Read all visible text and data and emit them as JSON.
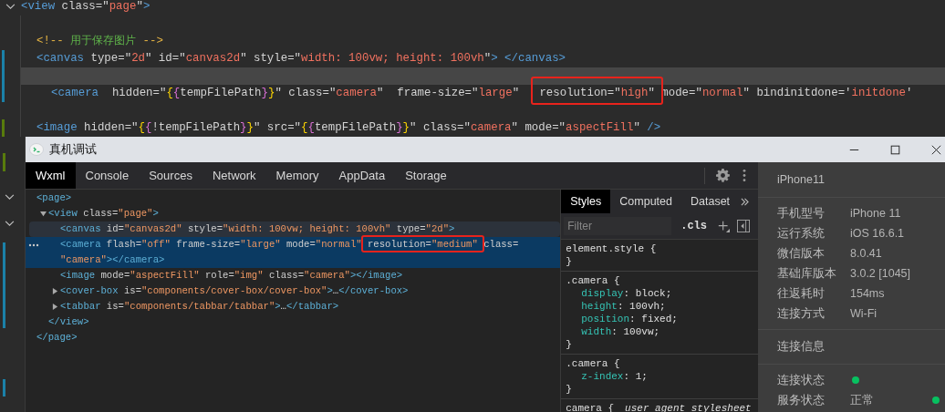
{
  "editor": {
    "lines": [
      {
        "expanded": true,
        "current": false,
        "tokens": [
          {
            "kind": "tag",
            "text": "<view"
          },
          {
            "kind": "attr",
            "text": " class=\""
          },
          {
            "kind": "str",
            "text": "page"
          },
          {
            "kind": "attr",
            "text": "\""
          },
          {
            "kind": "tag",
            "text": ">"
          }
        ],
        "children": [
          {
            "current": false
          },
          {
            "current": false,
            "tokens": [
              {
                "kind": "cmark",
                "text": "<!-- "
              },
              {
                "kind": "comment",
                "text": "用于保存图片"
              },
              {
                "kind": "cmark",
                "text": " -->"
              }
            ]
          },
          {
            "color": "#1b81a8",
            "current": false,
            "tokens": [
              {
                "kind": "tag",
                "text": "<canvas"
              },
              {
                "kind": "attr",
                "text": " type=\""
              },
              {
                "kind": "str",
                "text": "2d"
              },
              {
                "kind": "attr",
                "text": "\" id=\""
              },
              {
                "kind": "str",
                "text": "canvas2d"
              },
              {
                "kind": "attr",
                "text": "\" style=\""
              },
              {
                "kind": "str",
                "text": "width: 100vw; height: 100vh"
              },
              {
                "kind": "attr",
                "text": "\""
              },
              {
                "kind": "tag",
                "text": "> </canvas>"
              }
            ],
            "children": [
              {
                "color": "#1b81a8",
                "current": true
              },
              {
                "color": "#1b81a8",
                "current": false,
                "tokens": [
                  {
                    "kind": "tag",
                    "text": "<camera"
                  },
                  {
                    "kind": "attr",
                    "text": "  hidden=\""
                  },
                  {
                    "kind": "b1",
                    "text": "{"
                  },
                  {
                    "kind": "b2",
                    "text": "{"
                  },
                  {
                    "kind": "attr",
                    "text": "tempFilePath"
                  },
                  {
                    "kind": "b2",
                    "text": "}"
                  },
                  {
                    "kind": "b1",
                    "text": "}"
                  },
                  {
                    "kind": "attr",
                    "text": "\" class=\""
                  },
                  {
                    "kind": "str",
                    "text": "camera"
                  },
                  {
                    "kind": "attr",
                    "text": "\"  frame-size=\""
                  },
                  {
                    "kind": "str",
                    "text": "large"
                  },
                  {
                    "kind": "attr",
                    "text": "\"   "
                  },
                  {
                    "kind": "group",
                    "boxed": true,
                    "tokens": [
                      {
                        "kind": "attr",
                        "text": "resolution=\""
                      },
                      {
                        "kind": "str",
                        "text": "high"
                      },
                      {
                        "kind": "attr",
                        "text": "\""
                      }
                    ]
                  },
                  {
                    "kind": "attr",
                    "text": " mode=\""
                  },
                  {
                    "kind": "str",
                    "text": "normal"
                  },
                  {
                    "kind": "attr",
                    "text": "\" bindinitdone='"
                  },
                  {
                    "kind": "str",
                    "text": "initdone"
                  },
                  {
                    "kind": "attr",
                    "text": "'"
                  }
                ]
              },
              {
                "current": false
              }
            ]
          },
          {
            "color": "#587c0c",
            "current": false,
            "tokens": [
              {
                "kind": "tag",
                "text": "<image"
              },
              {
                "kind": "attr",
                "text": " hidden=\""
              },
              {
                "kind": "b1",
                "text": "{"
              },
              {
                "kind": "b2",
                "text": "{"
              },
              {
                "kind": "attr",
                "text": "!tempFilePath"
              },
              {
                "kind": "b2",
                "text": "}"
              },
              {
                "kind": "b1",
                "text": "}"
              },
              {
                "kind": "attr",
                "text": "\" src=\""
              },
              {
                "kind": "b1",
                "text": "{"
              },
              {
                "kind": "b2",
                "text": "{"
              },
              {
                "kind": "attr",
                "text": "tempFilePath"
              },
              {
                "kind": "b2",
                "text": "}"
              },
              {
                "kind": "b1",
                "text": "}"
              },
              {
                "kind": "attr",
                "text": "\" class=\""
              },
              {
                "kind": "str",
                "text": "camera"
              },
              {
                "kind": "attr",
                "text": "\" mode=\""
              },
              {
                "kind": "str",
                "text": "aspectFill"
              },
              {
                "kind": "attr",
                "text": "\" "
              },
              {
                "kind": "tag",
                "text": "/>"
              }
            ]
          }
        ]
      }
    ]
  },
  "window": {
    "title": "真机调试"
  },
  "tabs": [
    {
      "label": "Wxml",
      "selected": true
    },
    {
      "label": "Console",
      "selected": false
    },
    {
      "label": "Sources",
      "selected": false
    },
    {
      "label": "Network",
      "selected": false
    },
    {
      "label": "Memory",
      "selected": false
    },
    {
      "label": "AppData",
      "selected": false
    },
    {
      "label": "Storage",
      "selected": false
    }
  ],
  "tree": {
    "nodes": [
      {
        "selected": false,
        "hovered": false,
        "lines": [
          [
            {
              "kind": "tag",
              "text": "<page>"
            }
          ]
        ],
        "close": [
          {
            "kind": "tag",
            "text": "</page>"
          }
        ],
        "children": [
          {
            "selected": false,
            "hovered": false,
            "expanded": true,
            "lines": [
              [
                {
                  "kind": "tag",
                  "text": "<view"
                },
                {
                  "kind": "attr",
                  "text": " class="
                },
                {
                  "kind": "str",
                  "text": "\"page\""
                },
                {
                  "kind": "tag",
                  "text": ">"
                }
              ]
            ],
            "close": [
              {
                "kind": "tag",
                "text": "</view>"
              }
            ],
            "children": [
              {
                "selected": false,
                "hovered": true,
                "lines": [
                  [
                    {
                      "kind": "tag",
                      "text": "<canvas"
                    },
                    {
                      "kind": "attr",
                      "text": " id="
                    },
                    {
                      "kind": "str",
                      "text": "\"canvas2d\""
                    },
                    {
                      "kind": "attr",
                      "text": " style="
                    },
                    {
                      "kind": "str",
                      "text": "\"width: 100vw; height: 100vh\""
                    },
                    {
                      "kind": "attr",
                      "text": " type="
                    },
                    {
                      "kind": "str",
                      "text": "\"2d\""
                    },
                    {
                      "kind": "tag",
                      "text": ">"
                    }
                  ]
                ]
              },
              {
                "selected": true,
                "hovered": false,
                "lines": [
                  [
                    {
                      "kind": "tag",
                      "text": "<camera"
                    },
                    {
                      "kind": "attr",
                      "text": " flash="
                    },
                    {
                      "kind": "str",
                      "text": "\"off\""
                    },
                    {
                      "kind": "attr",
                      "text": " frame-size="
                    },
                    {
                      "kind": "str",
                      "text": "\"large\""
                    },
                    {
                      "kind": "attr",
                      "text": " mode="
                    },
                    {
                      "kind": "str",
                      "text": "\"normal\" "
                    },
                    {
                      "kind": "group",
                      "boxed": true,
                      "tokens": [
                        {
                          "kind": "attr",
                          "text": "resolution="
                        },
                        {
                          "kind": "str",
                          "text": "\"medium\""
                        }
                      ]
                    },
                    {
                      "kind": "attr",
                      "text": " class="
                    }
                  ],
                  [
                    {
                      "kind": "str",
                      "text": "\"camera\""
                    },
                    {
                      "kind": "tag",
                      "text": "></camera>"
                    }
                  ]
                ]
              },
              {
                "selected": false,
                "hovered": false,
                "lines": [
                  [
                    {
                      "kind": "tag",
                      "text": "<image"
                    },
                    {
                      "kind": "attr",
                      "text": " mode="
                    },
                    {
                      "kind": "str",
                      "text": "\"aspectFill\""
                    },
                    {
                      "kind": "attr",
                      "text": " role="
                    },
                    {
                      "kind": "str",
                      "text": "\"img\""
                    },
                    {
                      "kind": "attr",
                      "text": " class="
                    },
                    {
                      "kind": "str",
                      "text": "\"camera\""
                    },
                    {
                      "kind": "tag",
                      "text": "></image>"
                    }
                  ]
                ]
              },
              {
                "selected": false,
                "hovered": false,
                "expanded": false,
                "lines": [
                  [
                    {
                      "kind": "tag",
                      "text": "<cover-box"
                    },
                    {
                      "kind": "attr",
                      "text": " is="
                    },
                    {
                      "kind": "str",
                      "text": "\"components/cover-box/cover-box\""
                    },
                    {
                      "kind": "tag",
                      "text": ">"
                    },
                    {
                      "kind": "punct",
                      "text": "…"
                    },
                    {
                      "kind": "tag",
                      "text": "</cover-box>"
                    }
                  ]
                ]
              },
              {
                "selected": false,
                "hovered": false,
                "expanded": false,
                "lines": [
                  [
                    {
                      "kind": "tag",
                      "text": "<tabbar"
                    },
                    {
                      "kind": "attr",
                      "text": " is="
                    },
                    {
                      "kind": "str",
                      "text": "\"components/tabbar/tabbar\""
                    },
                    {
                      "kind": "tag",
                      "text": ">"
                    },
                    {
                      "kind": "punct",
                      "text": "…"
                    },
                    {
                      "kind": "tag",
                      "text": "</tabbar>"
                    }
                  ]
                ]
              }
            ]
          }
        ]
      }
    ]
  },
  "styles": {
    "tabs": [
      {
        "label": "Styles",
        "selected": true
      },
      {
        "label": "Computed",
        "selected": false
      },
      {
        "label": "Dataset",
        "selected": false
      }
    ],
    "filter": {
      "placeholder": "Filter"
    },
    "cls_button": ".cls",
    "rules": [
      {
        "selector": "element.style {",
        "close": "}"
      },
      {
        "selector": ".camera {",
        "props": [
          {
            "name": "display",
            "value": ": block;"
          },
          {
            "name": "height",
            "value": ": 100vh;"
          },
          {
            "name": "position",
            "value": ": fixed;"
          },
          {
            "name": "width",
            "value": ": 100vw;"
          }
        ],
        "close": "}"
      },
      {
        "selector": ".camera {",
        "props": [
          {
            "name": "z-index",
            "value": ": 1;"
          }
        ],
        "close": "}"
      },
      {
        "selector": "camera {",
        "source": "user agent stylesheet"
      }
    ]
  },
  "device_panel": {
    "title": "iPhone11",
    "sections": [
      {
        "rows": [
          {
            "label": "手机型号",
            "value": "iPhone 11"
          },
          {
            "label": "运行系统",
            "value": "iOS 16.6.1"
          },
          {
            "label": "微信版本",
            "value": "8.0.41"
          },
          {
            "label": "基础库版本",
            "value": "3.0.2 [1045]"
          },
          {
            "label": "往返耗时",
            "value": "154ms"
          },
          {
            "label": "连接方式",
            "value": "Wi-Fi"
          }
        ]
      },
      {
        "heading": "连接信息"
      },
      {
        "rows": [
          {
            "label": "连接状态",
            "color": "#07c160"
          },
          {
            "label": "服务状态",
            "value": "正常",
            "color": "#07c160"
          }
        ]
      }
    ]
  }
}
